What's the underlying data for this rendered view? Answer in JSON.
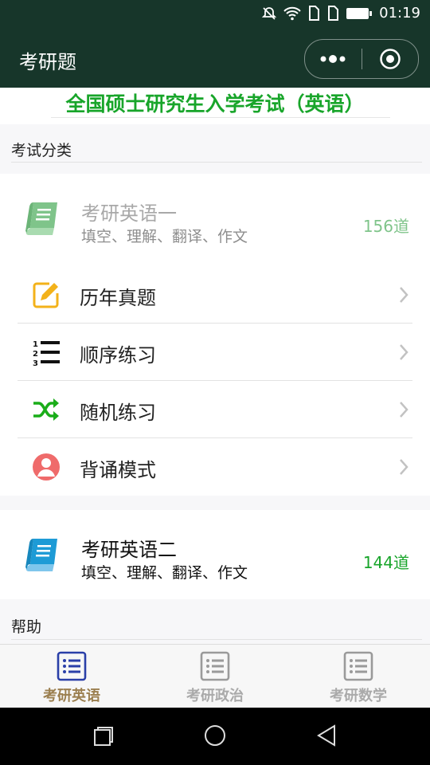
{
  "status": {
    "time": "01:19"
  },
  "appbar": {
    "title": "考研题",
    "more_icon": "more-dots-icon",
    "close_icon": "target-circle-icon"
  },
  "heading": "全国硕士研究生入学考试（英语）",
  "sections": {
    "categories_label": "考试分类",
    "help_label": "帮助"
  },
  "exams": [
    {
      "title": "考研英语一",
      "subtitle": "填空、理解、翻译、作文",
      "count": "156道",
      "icon": "green-book-icon",
      "color": "#7fc48a",
      "active": false
    },
    {
      "title": "考研英语二",
      "subtitle": "填空、理解、翻译、作文",
      "count": "144道",
      "icon": "blue-book-icon",
      "color": "#1e9bd6",
      "active": true
    }
  ],
  "menu": [
    {
      "label": "历年真题",
      "icon": "edit-icon"
    },
    {
      "label": "顺序练习",
      "icon": "ordered-list-icon"
    },
    {
      "label": "随机练习",
      "icon": "shuffle-icon"
    },
    {
      "label": "背诵模式",
      "icon": "user-circle-icon"
    }
  ],
  "tabs": [
    {
      "label": "考研英语",
      "active": true
    },
    {
      "label": "考研政治",
      "active": false
    },
    {
      "label": "考研数学",
      "active": false
    }
  ],
  "colors": {
    "header_bg": "#17362a",
    "green": "#18a52a",
    "tab_active": "#9b7f4f",
    "tab_inactive": "#aaaaaa"
  }
}
